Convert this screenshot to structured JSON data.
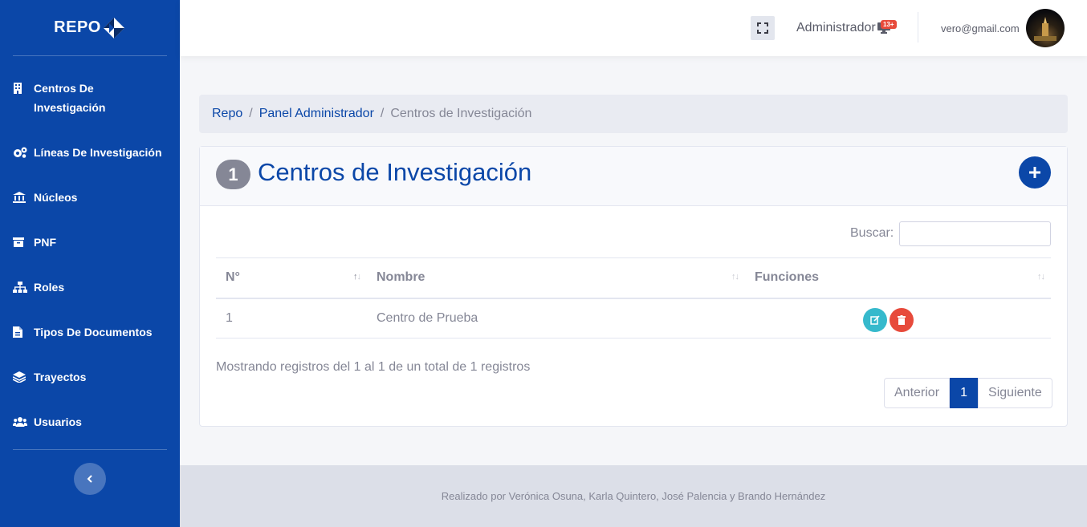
{
  "brand": {
    "name": "REPO"
  },
  "sidebar": {
    "items": [
      {
        "label": "Centros De Investigación",
        "icon": "building-icon"
      },
      {
        "label": "Líneas De Investigación",
        "icon": "gears-icon"
      },
      {
        "label": "Núcleos",
        "icon": "institution-icon"
      },
      {
        "label": "PNF",
        "icon": "archive-icon"
      },
      {
        "label": "Roles",
        "icon": "sitemap-icon"
      },
      {
        "label": "Tipos De Documentos",
        "icon": "document-icon"
      },
      {
        "label": "Trayectos",
        "icon": "layers-icon"
      },
      {
        "label": "Usuarios",
        "icon": "users-icon"
      }
    ],
    "toggle_icon": "chevron-left-icon"
  },
  "topbar": {
    "user_role": "Administrador",
    "notification_badge": "13+",
    "email": "vero@gmail.com"
  },
  "breadcrumb": {
    "items": [
      "Repo",
      "Panel Administrador"
    ],
    "current": "Centros de Investigación"
  },
  "card": {
    "count": "1",
    "title": "Centros de Investigación",
    "search_label": "Buscar:",
    "search_value": "",
    "columns": [
      "N°",
      "Nombre",
      "Funciones"
    ],
    "rows": [
      {
        "num": "1",
        "name": "Centro de Prueba"
      }
    ],
    "info": "Mostrando registros del 1 al 1 de un total de 1 registros",
    "pagination": {
      "prev": "Anterior",
      "current": "1",
      "next": "Siguiente"
    }
  },
  "colors": {
    "primary": "#0b47a8",
    "info": "#36b9cc",
    "danger": "#e74a3b"
  },
  "footer": {
    "text": "Realizado por Verónica Osuna, Karla Quintero, José Palencia y Brando Hernández"
  }
}
